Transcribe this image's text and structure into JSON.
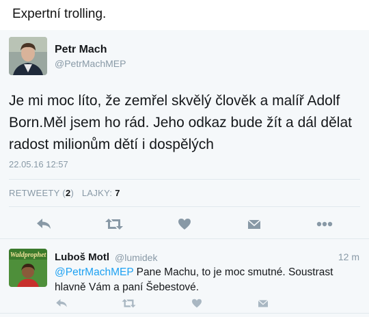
{
  "caption": "Expertní trolling.",
  "tweet": {
    "name": "Petr Mach",
    "handle": "@PetrMachMEP",
    "text": "Je mi moc líto, že zemřel skvělý člověk a malíř Adolf Born.Měl jsem ho rád. Jeho odkaz bude žít a dál dělat radost milionům dětí i dospělých",
    "date": "22.05.16 12:57",
    "retweets_label": "RETWEETY",
    "retweets_open": "(",
    "retweets_count": "2",
    "retweets_close": ")",
    "likes_label": "LAJKY:",
    "likes_count": "7"
  },
  "reply": {
    "name": "Luboš Motl",
    "handle": "@lumidek",
    "time": "12 m",
    "mention": "@PetrMachMEP",
    "text": " Pane Machu, to je moc smutné. Soustrast hlavně Vám a paní Šebestové.",
    "avatar_text": "Waldprophet"
  },
  "icons": {
    "reply": "reply-icon",
    "retweet": "retweet-icon",
    "like": "heart-icon",
    "dm": "envelope-icon",
    "more": "more-icon"
  },
  "colors": {
    "icon": "#8899a6",
    "link": "#1da1f2",
    "background": "#f5f8fa"
  }
}
